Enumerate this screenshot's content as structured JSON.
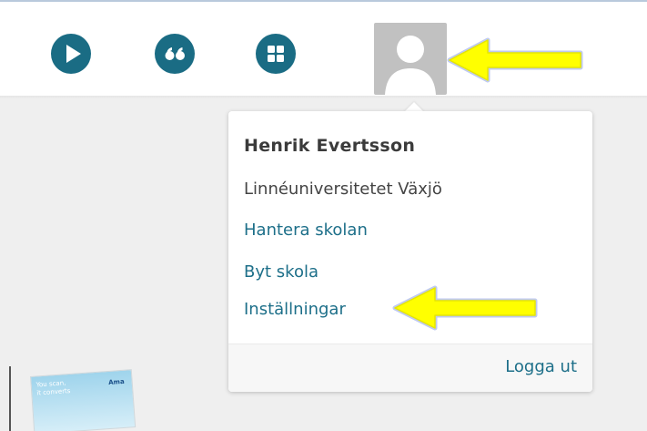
{
  "colors": {
    "icon_teal": "#1a6c84",
    "link_teal": "#1d6f89",
    "avatar_gray": "#c1c1c1",
    "annotation_yellow": "#ffff00",
    "annotation_glow": "#4a6bd8"
  },
  "toolbar": {
    "buttons": [
      {
        "icon": "play-icon"
      },
      {
        "icon": "quote-icon"
      },
      {
        "icon": "grid-icon"
      }
    ],
    "avatar_icon": "user-avatar-icon"
  },
  "user_menu": {
    "name": "Henrik Evertsson",
    "school": "Linnéuniversitetet Växjö",
    "links": [
      "Hantera skolan",
      "Byt skola",
      "Inställningar"
    ],
    "logout": "Logga ut"
  },
  "thumbnail": {
    "text_line1": "You scan,",
    "text_line2": "it converts",
    "logo": "Ama"
  }
}
